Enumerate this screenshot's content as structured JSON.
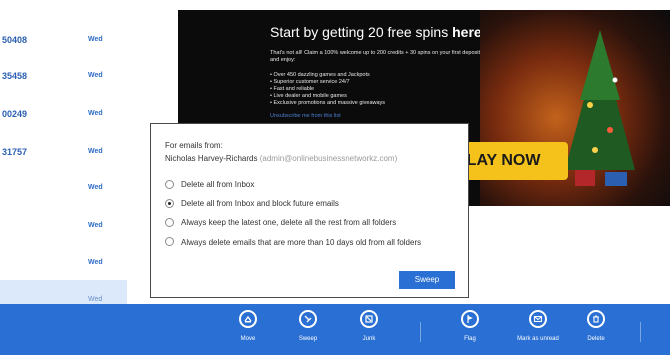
{
  "email_list": {
    "rows": [
      {
        "sender": "50408",
        "date": "Wed"
      },
      {
        "sender": "35458",
        "date": "Wed"
      },
      {
        "sender": "00249",
        "date": "Wed"
      },
      {
        "sender": "31757",
        "date": "Wed"
      },
      {
        "sender": "",
        "date": "Wed"
      },
      {
        "sender": "",
        "date": "Wed"
      },
      {
        "sender": "",
        "date": "Wed"
      },
      {
        "sender": "",
        "date": "Wed"
      }
    ]
  },
  "ad": {
    "title_plain": "Start by getting 20 free spins ",
    "title_bold": "here",
    "intro": "That's not all! Claim a 100% welcome up to 200 credits + 30 spins on your first deposit and enjoy:",
    "bullets": [
      "• Over 450 dazzling games and Jackpots",
      "• Superior customer service 24/7",
      "• Fast and reliable",
      "• Live dealer and mobile games",
      "• Exclusive promotions and massive giveaways"
    ],
    "unsubscribe": "Unsubscribe me from this list",
    "play_button": "& PLAY NOW"
  },
  "dialog": {
    "header": "For emails from:",
    "sender_name": "Nicholas Harvey-Richards",
    "sender_email": "(admin@onlinebusinessnetworkz.com)",
    "options": [
      {
        "label": "Delete all from Inbox",
        "checked": false
      },
      {
        "label": "Delete all from Inbox and block future emails",
        "checked": true
      },
      {
        "label": "Always keep the latest one, delete all the rest from all folders",
        "checked": false
      },
      {
        "label": "Always delete emails that are more than 10 days old from all folders",
        "checked": false
      }
    ],
    "sweep_button": "Sweep"
  },
  "appbar": {
    "commands": [
      {
        "label": "Move",
        "icon": "move-icon"
      },
      {
        "label": "Sweep",
        "icon": "sweep-icon"
      },
      {
        "label": "Junk",
        "icon": "junk-icon"
      },
      {
        "label": "Flag",
        "icon": "flag-icon"
      },
      {
        "label": "Mark as unread",
        "icon": "mark-unread-icon"
      },
      {
        "label": "Delete",
        "icon": "delete-icon"
      }
    ]
  },
  "colors": {
    "accent": "#2a6fd3",
    "list_text": "#2a5fb2",
    "selected_row": "#dbe9fb",
    "ad_button": "#f5c21b"
  }
}
